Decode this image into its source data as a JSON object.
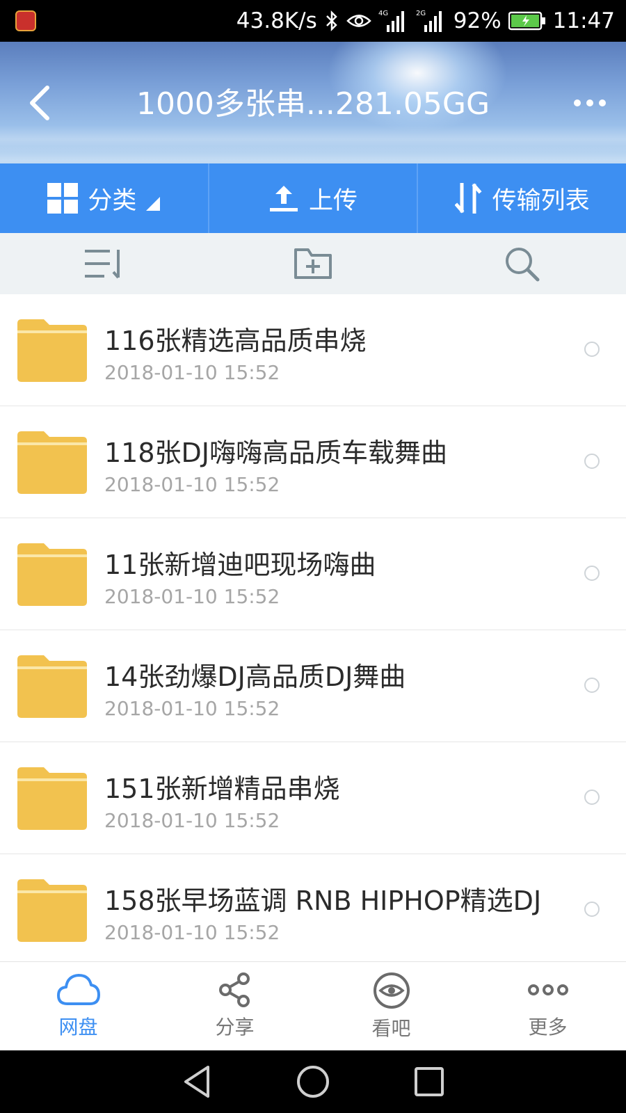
{
  "status_bar": {
    "speed": "43.8K/s",
    "net1": "4G",
    "net2": "2G",
    "battery": "92%",
    "time": "11:47"
  },
  "header": {
    "title": "1000多张串...281.05GG",
    "back_icon": "chevron-left-icon",
    "more_icon": "more-dots-icon"
  },
  "toolbar": {
    "category_label": "分类",
    "upload_label": "上传",
    "transfer_label": "传输列表"
  },
  "action_bar": {
    "sort_icon": "sort-icon",
    "new_folder_icon": "new-folder-icon",
    "search_icon": "search-icon"
  },
  "files": [
    {
      "name": "116张精选高品质串烧",
      "date": "2018-01-10  15:52"
    },
    {
      "name": "118张DJ嗨嗨高品质车载舞曲",
      "date": "2018-01-10  15:52"
    },
    {
      "name": "11张新增迪吧现场嗨曲",
      "date": "2018-01-10  15:52"
    },
    {
      "name": "14张劲爆DJ高品质DJ舞曲",
      "date": "2018-01-10  15:52"
    },
    {
      "name": "151张新增精品串烧",
      "date": "2018-01-10  15:52"
    },
    {
      "name": "158张早场蓝调 RNB HIPHOP精选DJ",
      "date": "2018-01-10  15:52"
    }
  ],
  "bottom_nav": [
    {
      "label": "网盘",
      "icon": "cloud-icon",
      "active": true
    },
    {
      "label": "分享",
      "icon": "share-icon",
      "active": false
    },
    {
      "label": "看吧",
      "icon": "eye-icon",
      "active": false
    },
    {
      "label": "更多",
      "icon": "more-circles-icon",
      "active": false
    }
  ],
  "colors": {
    "accent": "#3d8ff2",
    "folder": "#f2c24f",
    "action_bar_bg": "#eef2f4",
    "icon_gray": "#7a8c95"
  }
}
